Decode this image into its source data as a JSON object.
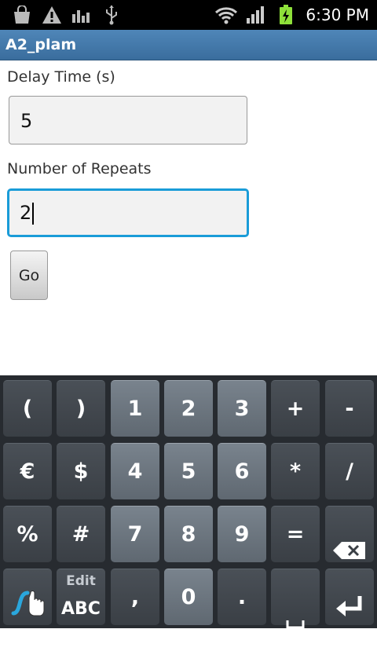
{
  "status": {
    "time": "6:30 PM"
  },
  "app": {
    "title": "A2_plam"
  },
  "form": {
    "delay_label": "Delay Time (s)",
    "delay_value": "5",
    "repeats_label": "Number of Repeats",
    "repeats_value": "2",
    "go_label": "Go"
  },
  "keyboard": {
    "row1": [
      "(",
      ")",
      "1",
      "2",
      "3",
      "+",
      "-"
    ],
    "row2": [
      "€",
      "$",
      "4",
      "5",
      "6",
      "*",
      "/"
    ],
    "row3": [
      "%",
      "#",
      "7",
      "8",
      "9",
      "="
    ],
    "row4": {
      "mode_top": "Edit",
      "mode_bottom": "ABC",
      "comma": ",",
      "zero": "0",
      "period": "."
    }
  },
  "colors": {
    "accent": "#1a9cd8",
    "titlebar": "#3f74a6"
  }
}
